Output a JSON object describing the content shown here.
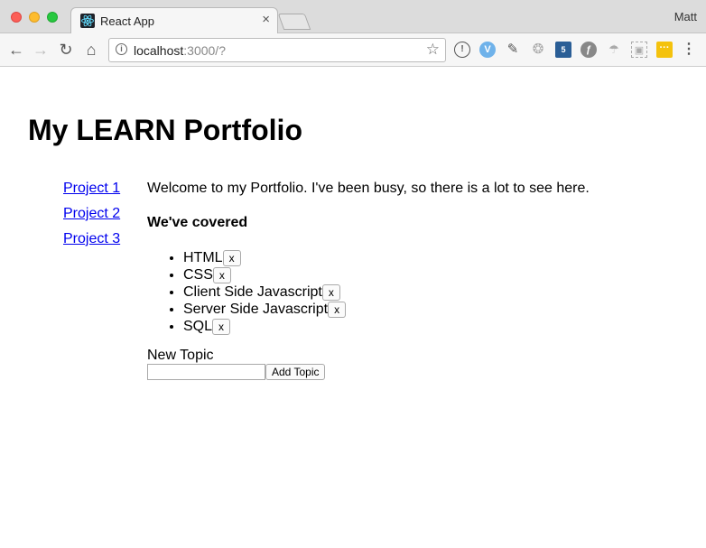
{
  "browser": {
    "tab_title": "React App",
    "tab_close": "×",
    "profile_name": "Matt",
    "url_host": "localhost",
    "url_rest": ":3000/?",
    "icons": {
      "back": "←",
      "forward": "→",
      "reload": "↻",
      "home": "⌂",
      "info": "i",
      "star": "☆",
      "menu": "⋮"
    },
    "extensions": [
      {
        "glyph": "!"
      },
      {
        "glyph": "V"
      },
      {
        "glyph": "✎"
      },
      {
        "glyph": "❂"
      },
      {
        "glyph": "5"
      },
      {
        "glyph": "ƒ"
      },
      {
        "glyph": "☂"
      },
      {
        "glyph": "▣"
      },
      {
        "glyph": "···"
      }
    ]
  },
  "page": {
    "title": "My LEARN Portfolio",
    "sidebar": {
      "links": [
        {
          "label": "Project 1"
        },
        {
          "label": "Project 2"
        },
        {
          "label": "Project 3"
        }
      ]
    },
    "main": {
      "welcome": "Welcome to my Portfolio. I've been busy, so there is a lot to see here.",
      "covered_heading": "We've covered",
      "topics": [
        {
          "label": "HTML",
          "remove_label": "x"
        },
        {
          "label": "CSS",
          "remove_label": "x"
        },
        {
          "label": "Client Side Javascript",
          "remove_label": "x"
        },
        {
          "label": "Server Side Javascript",
          "remove_label": "x"
        },
        {
          "label": "SQL",
          "remove_label": "x"
        }
      ],
      "new_topic_label": "New Topic",
      "new_topic_value": "",
      "add_topic_label": "Add Topic"
    }
  }
}
